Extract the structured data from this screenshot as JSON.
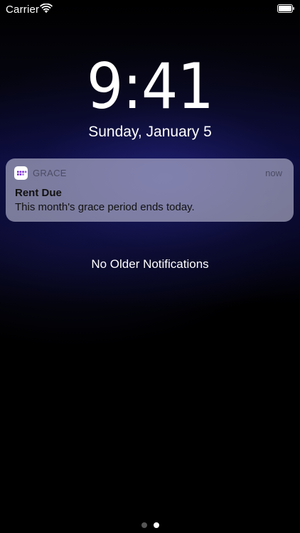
{
  "status_bar": {
    "carrier": "Carrier",
    "wifi_icon": "wifi-icon",
    "battery_icon": "battery-full-icon"
  },
  "lock_screen": {
    "time": "9:41",
    "date": "Sunday, January 5"
  },
  "notification": {
    "app_icon": "grace-app-icon",
    "app_name": "GRACE",
    "time": "now",
    "title": "Rent Due",
    "body": "This month's grace period ends today."
  },
  "footer_text": "No Older Notifications",
  "page_indicator": {
    "pages": 2,
    "current": 2
  },
  "colors": {
    "app_icon_purple": "#7a2bd6",
    "notification_bg": "#b9b9d3"
  }
}
